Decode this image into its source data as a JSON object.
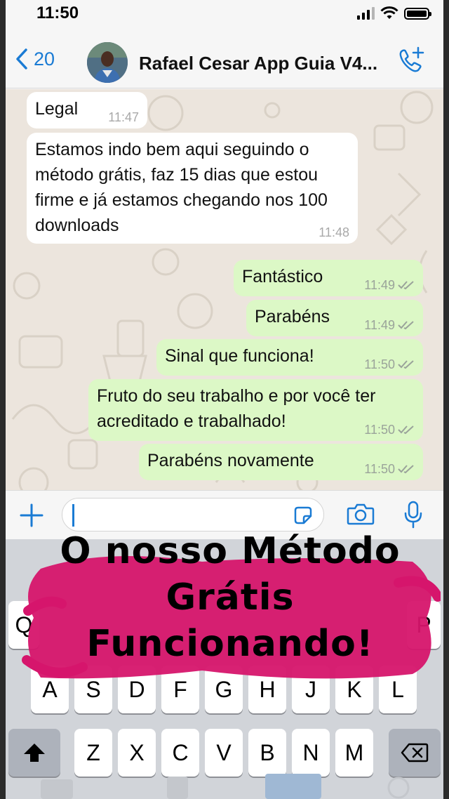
{
  "status": {
    "time": "11:50"
  },
  "header": {
    "back_count": "20",
    "contact_name": "Rafael Cesar App Guia V4..."
  },
  "messages": [
    {
      "dir": "in",
      "text": "Legal",
      "time": "11:47"
    },
    {
      "dir": "in",
      "text": "Estamos indo bem aqui seguindo o método grátis, faz 15 dias que estou firme e já estamos chegando nos 100 downloads",
      "time": "11:48"
    },
    {
      "dir": "out",
      "text": "Fantástico",
      "time": "11:49"
    },
    {
      "dir": "out",
      "text": "Parabéns",
      "time": "11:49"
    },
    {
      "dir": "out",
      "text": "Sinal que funciona!",
      "time": "11:50"
    },
    {
      "dir": "out",
      "text": "Fruto do seu trabalho e por você ter acreditado e trabalhado!",
      "time": "11:50"
    },
    {
      "dir": "out",
      "text": "Parabéns novamente",
      "time": "11:50"
    }
  ],
  "keyboard": {
    "row1": [
      "Q",
      "P"
    ],
    "row2": [
      "A",
      "S",
      "D",
      "F",
      "G",
      "H",
      "J",
      "K",
      "L"
    ],
    "row3": [
      "Z",
      "X",
      "C",
      "V",
      "B",
      "N",
      "M"
    ]
  },
  "overlay": {
    "line1": "O nosso Método",
    "line2": "Grátis",
    "line3": "Funcionando!",
    "highlight_color": "#d6156c"
  },
  "colors": {
    "accent": "#1a7bd4",
    "outgoing_bubble": "#dcf8c6",
    "chat_background": "#ece5dd"
  }
}
